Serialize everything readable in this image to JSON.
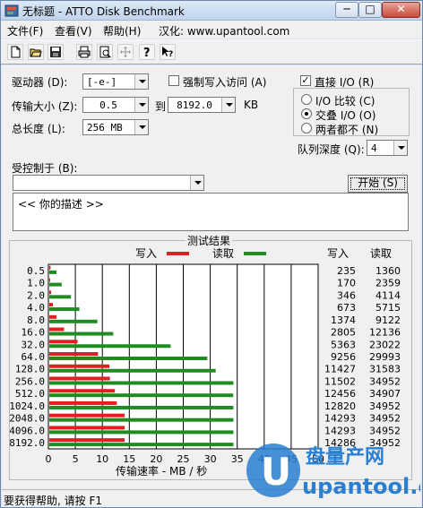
{
  "window": {
    "title": "无标题 - ATTO Disk Benchmark",
    "buttons": {
      "minimize": "─",
      "maximize": "□",
      "close": "✕"
    }
  },
  "menu": {
    "file": "文件(F)",
    "view": "查看(V)",
    "help": "帮助(H)",
    "localized": "汉化: www.upantool.com"
  },
  "toolbar": {
    "icons": [
      "new-document-icon",
      "open-folder-icon",
      "save-disk-icon",
      "print-icon",
      "print-preview-icon",
      "move-icon",
      "help-question-icon",
      "context-help-icon"
    ]
  },
  "settings": {
    "drive_label": "驱动器 (D):",
    "drive_value": "[-e-]",
    "transfer_label": "传输大小 (Z):",
    "transfer_from": "0.5",
    "to_label": "到",
    "transfer_to": "8192.0",
    "kb_unit": "KB",
    "total_label": "总长度 (L):",
    "total_value": "256 MB",
    "force_write_label": "强制写入访问 (A)",
    "force_write_checked": false,
    "direct_io_label": "直接 I/O (R)",
    "direct_io_checked": true,
    "io_compare_label": "I/O 比较 (C)",
    "overlap_io_label": "交叠 I/O (O)",
    "neither_label": "两者都不 (N)",
    "selected_io_mode": "overlap",
    "queue_depth_label": "队列深度 (Q):",
    "queue_depth_value": "4",
    "controlled_by_label": "受控制于 (B):",
    "controlled_by_value": "",
    "start_label": "开始 (S)",
    "description": "<<   你的描述   >>"
  },
  "results": {
    "group_title": "测试结果",
    "legend_write": "写入",
    "legend_read": "读取",
    "col_write": "写入",
    "col_read": "读取",
    "x_axis_label": "传输速率 - MB / 秒"
  },
  "chart_data": {
    "type": "bar",
    "orientation": "horizontal",
    "categories": [
      "0.5",
      "1.0",
      "2.0",
      "4.0",
      "8.0",
      "16.0",
      "32.0",
      "64.0",
      "128.0",
      "256.0",
      "512.0",
      "1024.0",
      "2048.0",
      "4096.0",
      "8192.0"
    ],
    "x_ticks": [
      "0",
      "5",
      "10",
      "15",
      "20",
      "25",
      "30",
      "35",
      "40",
      "45",
      "50"
    ],
    "xlim": [
      0,
      50
    ],
    "xlabel": "传输速率 - MB / 秒",
    "series": [
      {
        "name": "写入",
        "color": "#e02020",
        "values": [
          0.23,
          0.17,
          0.34,
          0.66,
          1.34,
          2.74,
          5.24,
          9.04,
          11.16,
          11.23,
          12.16,
          12.52,
          13.96,
          13.96,
          13.95
        ],
        "labels": [
          "235",
          "170",
          "346",
          "673",
          "1374",
          "2805",
          "5363",
          "9256",
          "11427",
          "11502",
          "12456",
          "12820",
          "14293",
          "14293",
          "14286"
        ]
      },
      {
        "name": "读取",
        "color": "#1e8c1e",
        "values": [
          1.33,
          2.3,
          4.02,
          5.58,
          8.91,
          11.85,
          22.48,
          29.29,
          30.84,
          34.13,
          34.09,
          34.13,
          34.13,
          34.13,
          34.13
        ],
        "labels": [
          "1360",
          "2359",
          "4114",
          "5715",
          "9122",
          "12136",
          "23022",
          "29993",
          "31583",
          "34952",
          "34907",
          "34952",
          "34952",
          "34952",
          "34952"
        ]
      }
    ],
    "grid": true
  },
  "status": {
    "text": "要获得帮助, 请按 F1"
  },
  "watermark": {
    "logo_text": "盘量产网",
    "url": "upantool.com",
    "letter": "U"
  }
}
